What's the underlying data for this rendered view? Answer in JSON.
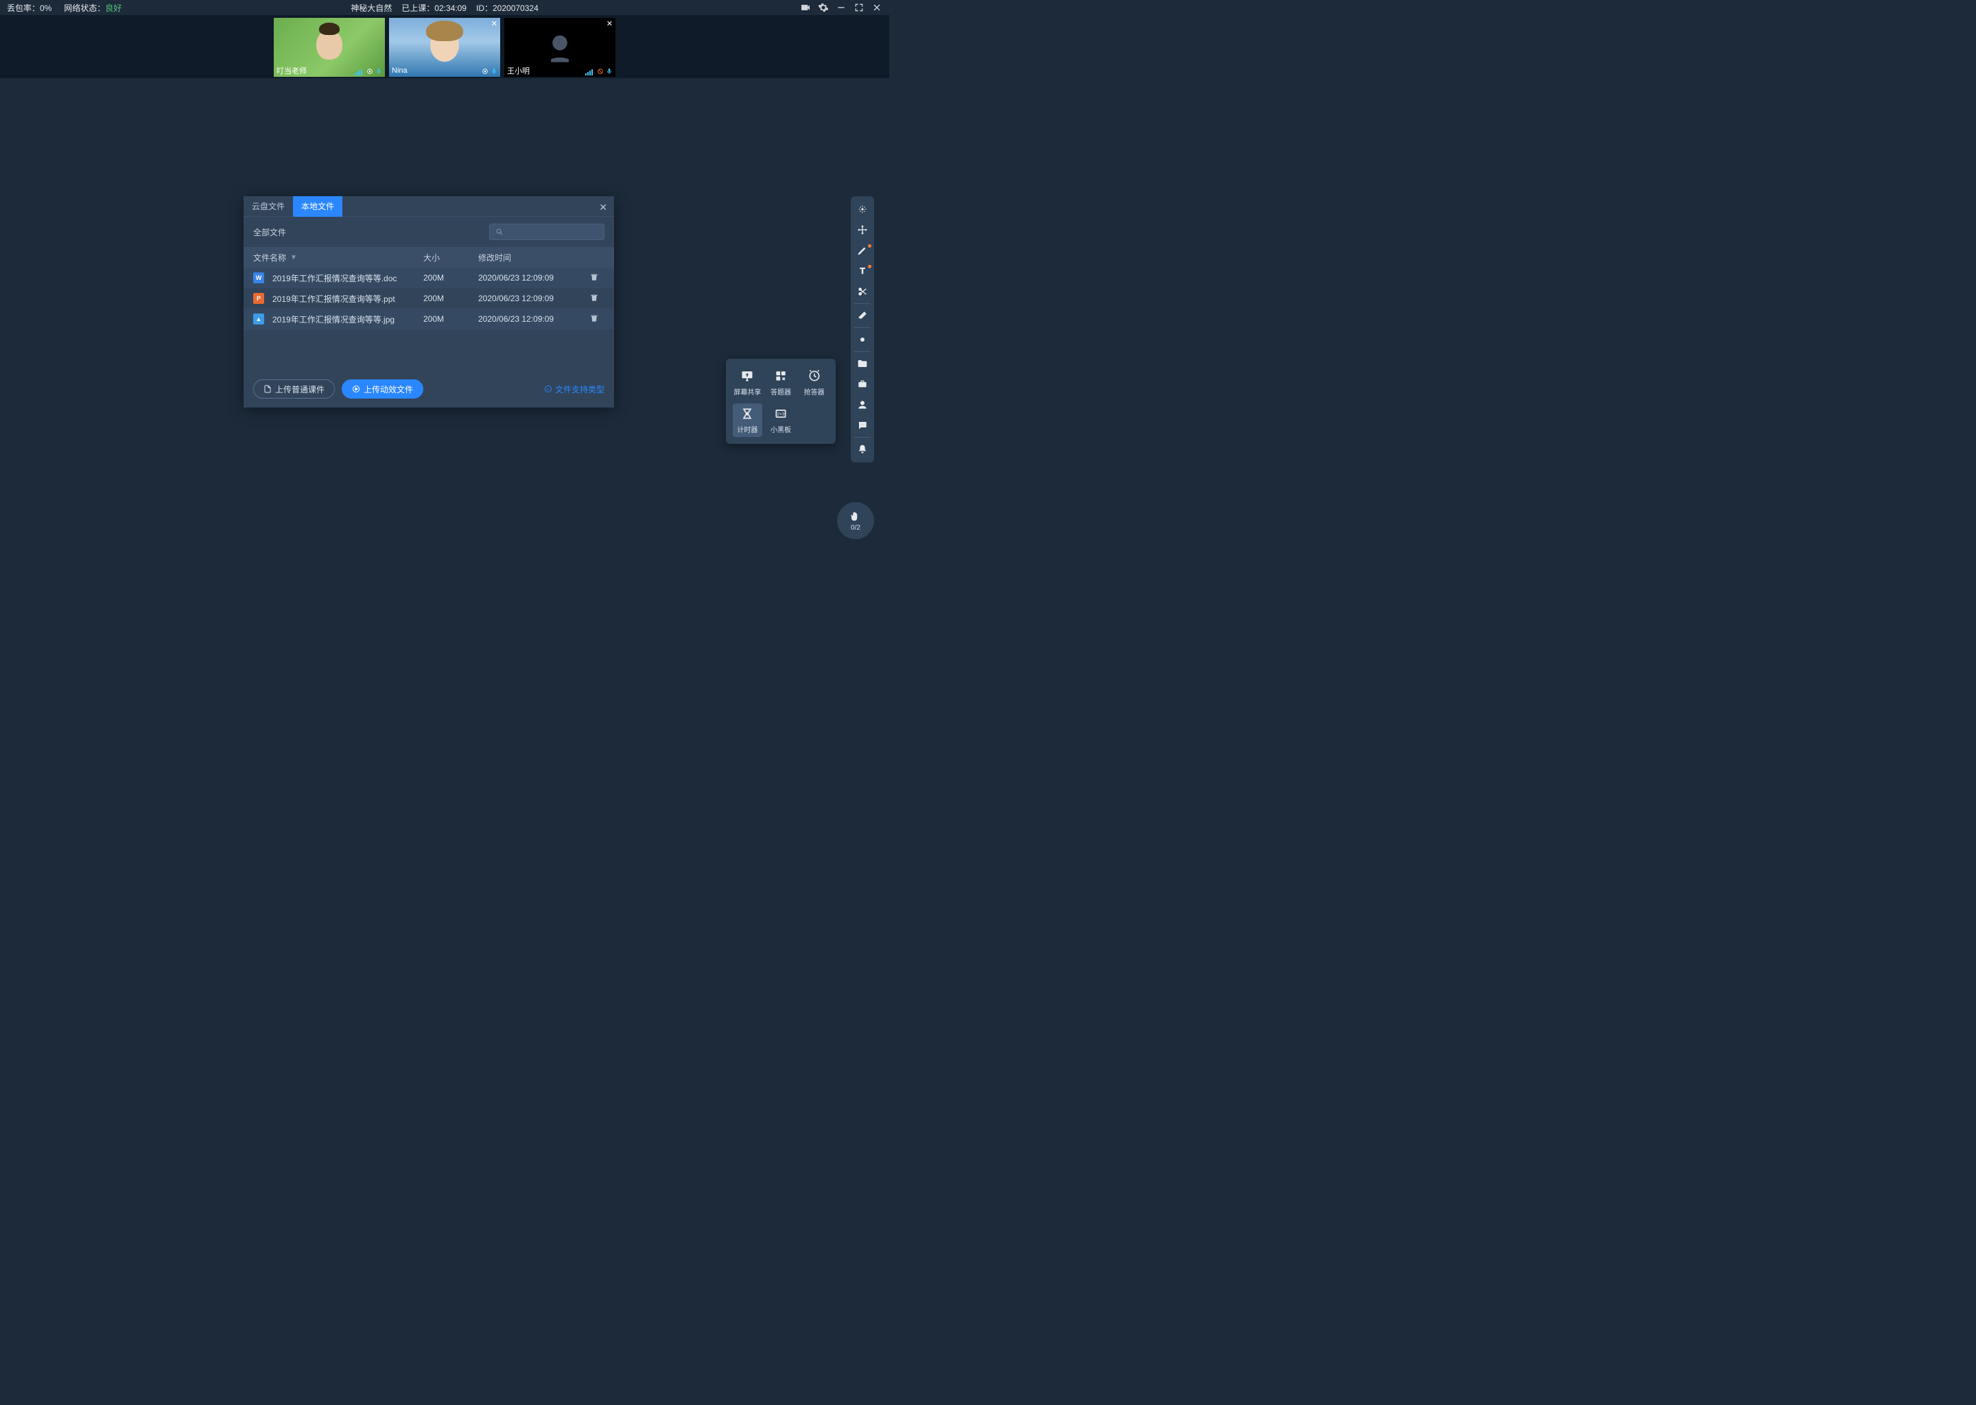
{
  "topbar": {
    "packet_loss_label": "丢包率：",
    "packet_loss_value": "0%",
    "network_label": "网络状态：",
    "network_value": "良好",
    "title": "神秘大自然",
    "elapsed_label": "已上课：",
    "elapsed_value": "02:34:09",
    "id_label": "ID：",
    "id_value": "2020070324"
  },
  "videos": [
    {
      "name": "叮当老师",
      "mic_muted": false,
      "closable": false
    },
    {
      "name": "Nina",
      "mic_muted": false,
      "closable": true
    },
    {
      "name": "王小明",
      "mic_muted": true,
      "closable": true
    }
  ],
  "dialog": {
    "tabs": [
      "云盘文件",
      "本地文件"
    ],
    "active_tab": 1,
    "search_label": "全部文件",
    "columns": {
      "name": "文件名称",
      "size": "大小",
      "time": "修改时间"
    },
    "rows": [
      {
        "icon": "doc",
        "icon_letter": "W",
        "name": "2019年工作汇报情况查询等等.doc",
        "size": "200M",
        "time": "2020/06/23 12:09:09"
      },
      {
        "icon": "ppt",
        "icon_letter": "P",
        "name": "2019年工作汇报情况查询等等.ppt",
        "size": "200M",
        "time": "2020/06/23 12:09:09"
      },
      {
        "icon": "img",
        "icon_letter": "▲",
        "name": "2019年工作汇报情况查询等等.jpg",
        "size": "200M",
        "time": "2020/06/23 12:09:09"
      }
    ],
    "btn_upload_normal": "上传普通课件",
    "btn_upload_anim": "上传动效文件",
    "support_link": "文件支持类型"
  },
  "tools_popup": [
    {
      "id": "screen-share",
      "label": "屏幕共享"
    },
    {
      "id": "answer",
      "label": "答题器"
    },
    {
      "id": "buzzer",
      "label": "抢答器"
    },
    {
      "id": "timer",
      "label": "计时器",
      "active": true
    },
    {
      "id": "blackboard",
      "label": "小黑板"
    }
  ],
  "right_toolbar": [
    {
      "id": "laser",
      "name": "laser-pointer-icon"
    },
    {
      "id": "move",
      "name": "move-icon"
    },
    {
      "id": "pen",
      "name": "pen-icon",
      "dot": true
    },
    {
      "id": "text",
      "name": "text-icon",
      "dot": true
    },
    {
      "id": "scissors",
      "name": "scissors-icon"
    },
    {
      "id": "sep1",
      "sep": true
    },
    {
      "id": "eraser",
      "name": "eraser-icon"
    },
    {
      "id": "sep2",
      "sep": true
    },
    {
      "id": "circle",
      "name": "shape-circle-icon"
    },
    {
      "id": "sep3",
      "sep": true
    },
    {
      "id": "folder",
      "name": "folder-icon"
    },
    {
      "id": "toolbox",
      "name": "toolbox-icon"
    },
    {
      "id": "user",
      "name": "user-icon"
    },
    {
      "id": "chat",
      "name": "chat-icon"
    },
    {
      "id": "sep4",
      "sep": true
    },
    {
      "id": "bell",
      "name": "bell-icon"
    }
  ],
  "hand": {
    "count": "0/2"
  }
}
